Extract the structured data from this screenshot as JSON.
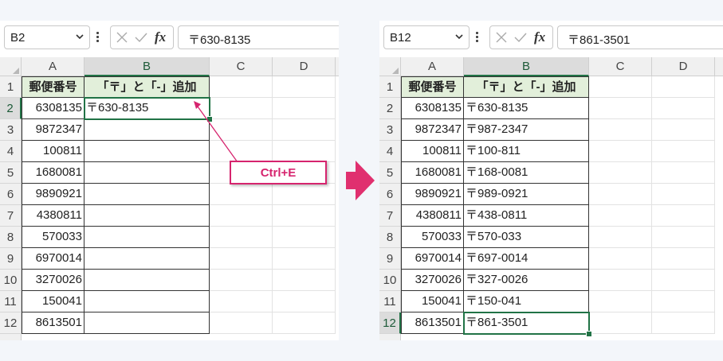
{
  "colors": {
    "accent_green": "#217346",
    "header_fill": "#e2efda",
    "callout_pink": "#d6246e"
  },
  "left": {
    "namebox": "B2",
    "formula": "〒630-8135",
    "fx_label": "fx",
    "columns": [
      "A",
      "B",
      "C",
      "D"
    ],
    "rows": [
      "1",
      "2",
      "3",
      "4",
      "5",
      "6",
      "7",
      "8",
      "9",
      "10",
      "11",
      "12"
    ],
    "header_a": "郵便番号",
    "header_b": "「〒」と「-」追加",
    "codes": [
      "6308135",
      "9872347",
      "100811",
      "1680081",
      "9890921",
      "4380811",
      "570033",
      "6970014",
      "3270026",
      "150041",
      "8613501"
    ],
    "results": [
      "〒630-8135",
      "",
      "",
      "",
      "",
      "",
      "",
      "",
      "",
      "",
      ""
    ]
  },
  "callout": {
    "label": "Ctrl+E"
  },
  "right": {
    "namebox": "B12",
    "formula": "〒861-3501",
    "fx_label": "fx",
    "columns": [
      "A",
      "B",
      "C",
      "D"
    ],
    "rows": [
      "1",
      "2",
      "3",
      "4",
      "5",
      "6",
      "7",
      "8",
      "9",
      "10",
      "11",
      "12"
    ],
    "header_a": "郵便番号",
    "header_b": "「〒」と「-」追加",
    "codes": [
      "6308135",
      "9872347",
      "100811",
      "1680081",
      "9890921",
      "4380811",
      "570033",
      "6970014",
      "3270026",
      "150041",
      "8613501"
    ],
    "results": [
      "〒630-8135",
      "〒987-2347",
      "〒100-811",
      "〒168-0081",
      "〒989-0921",
      "〒438-0811",
      "〒570-033",
      "〒697-0014",
      "〒327-0026",
      "〒150-041",
      "〒861-3501"
    ]
  }
}
